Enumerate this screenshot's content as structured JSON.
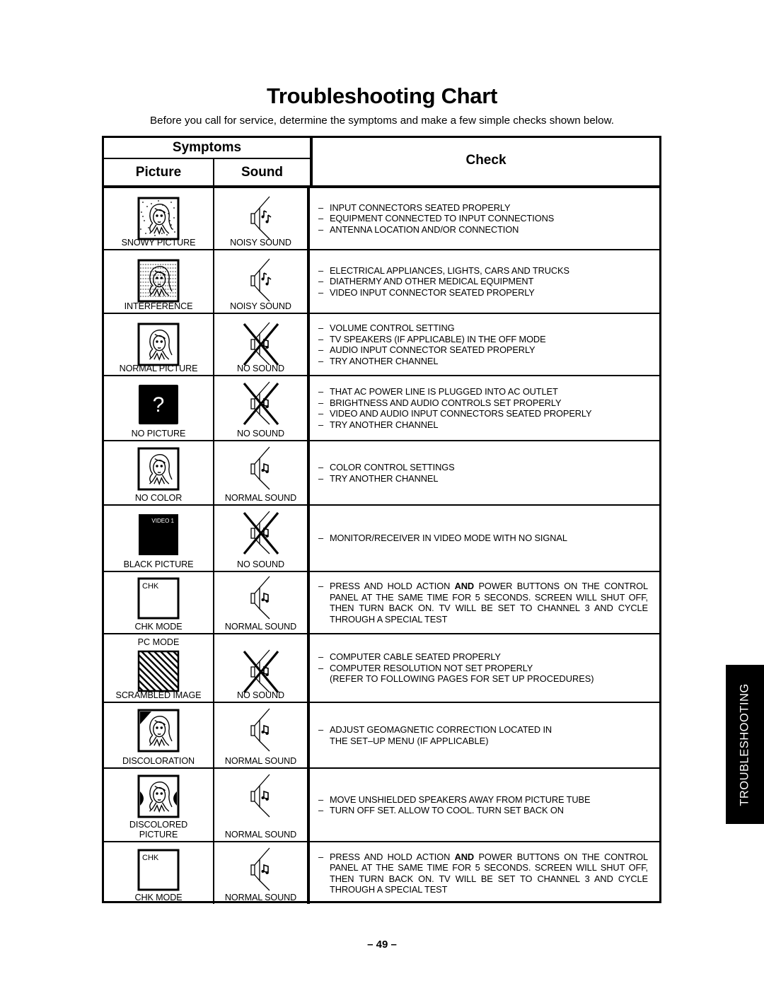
{
  "page": {
    "title": "Troubleshooting Chart",
    "subtitle": "Before you call for service, determine the symptoms and make a few simple checks shown below.",
    "page_number": "– 49 –",
    "side_tab": "TROUBLESHOOTING"
  },
  "table": {
    "headers": {
      "symptoms": "Symptoms",
      "picture": "Picture",
      "sound": "Sound",
      "check": "Check"
    },
    "rows": [
      {
        "picture": "SNOWY PICTURE",
        "picture_icon": "snowy-picture-icon",
        "sound": "NOISY SOUND",
        "sound_icon": "noisy-speaker-icon",
        "checks": [
          "INPUT CONNECTORS SEATED PROPERLY",
          "EQUIPMENT CONNECTED TO INPUT CONNECTIONS",
          "ANTENNA LOCATION AND/OR CONNECTION"
        ]
      },
      {
        "picture": "INTERFERENCE",
        "picture_icon": "interference-picture-icon",
        "sound": "NOISY SOUND",
        "sound_icon": "noisy-speaker-icon",
        "checks": [
          "ELECTRICAL APPLIANCES, LIGHTS, CARS AND TRUCKS",
          "DIATHERMY AND OTHER MEDICAL EQUIPMENT",
          "VIDEO INPUT CONNECTOR SEATED PROPERLY"
        ]
      },
      {
        "picture": "NORMAL PICTURE",
        "picture_icon": "normal-picture-icon",
        "sound": "NO SOUND",
        "sound_icon": "muted-speaker-icon",
        "checks": [
          "VOLUME CONTROL SETTING",
          "TV SPEAKERS (IF APPLICABLE) IN THE OFF MODE",
          "AUDIO INPUT CONNECTOR SEATED PROPERLY",
          "TRY ANOTHER CHANNEL"
        ]
      },
      {
        "picture": "NO PICTURE",
        "picture_icon": "no-picture-question-icon",
        "picture_glyph": "?",
        "sound": "NO SOUND",
        "sound_icon": "muted-speaker-icon",
        "checks": [
          "THAT AC POWER LINE IS PLUGGED INTO AC OUTLET",
          "BRIGHTNESS AND AUDIO CONTROLS SET PROPERLY",
          "VIDEO AND AUDIO INPUT CONNECTORS SEATED PROPERLY",
          "TRY ANOTHER CHANNEL"
        ]
      },
      {
        "picture": "NO COLOR",
        "picture_icon": "normal-picture-icon",
        "sound": "NORMAL SOUND",
        "sound_icon": "normal-speaker-icon",
        "checks": [
          "COLOR CONTROL SETTINGS",
          "TRY ANOTHER CHANNEL"
        ]
      },
      {
        "picture": "BLACK  PICTURE",
        "picture_icon": "black-screen-video1-icon",
        "picture_glyph": "VIDEO 1",
        "sound": "NO SOUND",
        "sound_icon": "muted-speaker-icon",
        "checks": [
          "MONITOR/RECEIVER IN VIDEO MODE WITH NO SIGNAL"
        ]
      },
      {
        "picture": "CHK MODE",
        "picture_icon": "chk-screen-icon",
        "picture_glyph": "CHK",
        "sound": "NORMAL SOUND",
        "sound_icon": "normal-speaker-icon",
        "checks_rich": {
          "pre": "PRESS AND HOLD ACTION ",
          "bold": "AND",
          "post": " POWER BUTTONS ON THE CONTROL PANEL AT THE SAME TIME FOR 5 SECONDS. SCREEN WILL SHUT OFF, THEN TURN BACK ON.  TV WILL BE SET TO CHANNEL 3 AND CYCLE THROUGH A SPECIAL TEST"
        }
      },
      {
        "picture_top": "PC MODE",
        "picture": "SCRAMBLED IMAGE",
        "picture_icon": "scrambled-image-icon",
        "sound": "NO SOUND",
        "sound_icon": "muted-speaker-icon",
        "checks": [
          "COMPUTER CABLE SEATED PROPERLY",
          "COMPUTER RESOLUTION NOT SET PROPERLY"
        ],
        "checks_note": "(REFER TO FOLLOWING PAGES FOR SET UP PROCEDURES)"
      },
      {
        "picture": "DISCOLORATION",
        "picture_icon": "discoloration-picture-icon",
        "sound": "NORMAL SOUND",
        "sound_icon": "normal-speaker-icon",
        "checks": [
          "ADJUST GEOMAGNETIC CORRECTION LOCATED IN"
        ],
        "checks_note": "THE SET–UP MENU (IF APPLICABLE)"
      },
      {
        "picture": "DISCOLORED",
        "picture_line2": "PICTURE",
        "picture_icon": "discolored-picture-icon",
        "sound": "NORMAL SOUND",
        "sound_icon": "normal-speaker-icon",
        "checks": [
          "MOVE UNSHIELDED SPEAKERS AWAY FROM PICTURE TUBE",
          "TURN OFF SET.  ALLOW TO COOL.  TURN SET BACK ON"
        ]
      },
      {
        "picture": "CHK MODE",
        "picture_icon": "chk-screen-icon",
        "picture_glyph": "CHK",
        "sound": "NORMAL SOUND",
        "sound_icon": "normal-speaker-icon",
        "checks_rich": {
          "pre": "PRESS AND HOLD ACTION ",
          "bold": "AND",
          "post": " POWER BUTTONS ON THE CONTROL PANEL AT THE SAME TIME FOR 5 SECONDS. SCREEN WILL SHUT OFF, THEN TURN BACK ON.  TV WILL BE SET TO CHANNEL 3 AND CYCLE THROUGH A SPECIAL TEST"
        }
      }
    ]
  }
}
